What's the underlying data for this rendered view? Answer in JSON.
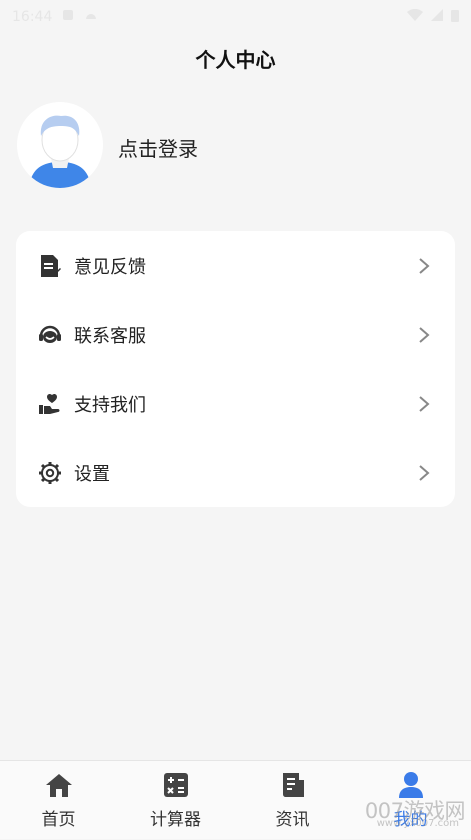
{
  "status_bar": {
    "time": "16:44"
  },
  "header": {
    "title": "个人中心"
  },
  "profile": {
    "login_label": "点击登录"
  },
  "menu": {
    "items": [
      {
        "label": "意见反馈",
        "icon": "feedback-icon"
      },
      {
        "label": "联系客服",
        "icon": "headset-icon"
      },
      {
        "label": "支持我们",
        "icon": "support-icon"
      },
      {
        "label": "设置",
        "icon": "gear-icon"
      }
    ]
  },
  "tabbar": {
    "items": [
      {
        "label": "首页",
        "icon": "home-icon"
      },
      {
        "label": "计算器",
        "icon": "calculator-icon"
      },
      {
        "label": "资讯",
        "icon": "news-icon"
      },
      {
        "label": "我的",
        "icon": "user-icon",
        "active": true
      }
    ]
  },
  "watermark": {
    "text": "007游戏网",
    "url": "www.yx007.com"
  },
  "colors": {
    "accent": "#3a7be8",
    "background": "#f5f5f5",
    "card": "#ffffff"
  }
}
